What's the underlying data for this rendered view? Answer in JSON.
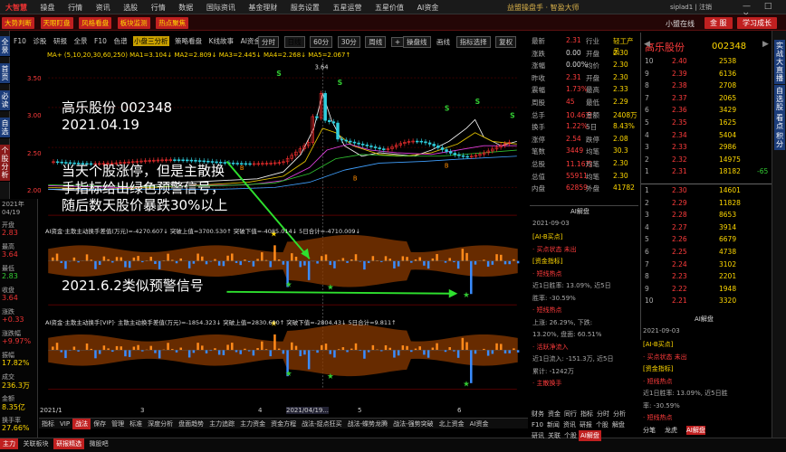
{
  "titlebar": {
    "logo": "大智慧",
    "menus": [
      "操盘",
      "行情",
      "资讯",
      "选股",
      "行情",
      "数据",
      "国际资讯",
      "基金理财",
      "服务设置",
      "五星运营",
      "五星价值",
      "AI资金"
    ],
    "app_title": "益盟操盘手 · 智盈大师",
    "user": "siplad1 | 注销"
  },
  "toolbar": {
    "buttons": [
      "大势判断",
      "天眼盯盘",
      "风格看盘",
      "板块监测",
      "热点聚焦"
    ],
    "service": "小盟在线",
    "right_btns": [
      "金 服",
      "学习成长"
    ]
  },
  "left_side": [
    "全景",
    "首页",
    "必读",
    "自选",
    "个股分析"
  ],
  "right_side": [
    "实战大直播",
    "自选股",
    "看点",
    "积分"
  ],
  "chart_tabs": {
    "items": [
      "F10",
      "诊股",
      "研报",
      "全景",
      "F10",
      "色谱",
      "小盘三分析",
      "策略看盘",
      "K线故事",
      "AI资金"
    ],
    "active": "小盘三分析",
    "period": [
      "分时",
      "日线",
      "60分",
      "30分",
      "周线"
    ],
    "period_active": "日线",
    "right_items": [
      "操盘线",
      "画线",
      "指标选择",
      "复权"
    ]
  },
  "ma_line": "MA+ (5,10,20,30,60,250)  MA1=3.104↓ MA2=2.809↓ MA3=2.445↓ MA4=2.268↓ MA5=2.067↑",
  "price_axis": [
    "3.50",
    "3.00",
    "2.50",
    "2.00"
  ],
  "high_label": "3.64",
  "left_info": {
    "date": "2021年\n04/19",
    "rows": [
      {
        "k": "开盘",
        "v": "2.83"
      },
      {
        "k": "最高",
        "v": "3.64"
      },
      {
        "k": "最低",
        "v": "2.83"
      },
      {
        "k": "收盘",
        "v": "3.64"
      },
      {
        "k": "涨跌",
        "v": "+0.33"
      },
      {
        "k": "涨跌幅",
        "v": "+9.97%"
      },
      {
        "k": "振幅",
        "v": "17.82%"
      },
      {
        "k": "成交",
        "v": "236.3万"
      },
      {
        "k": "金额",
        "v": "8.35亿"
      },
      {
        "k": "换手率",
        "v": "27.66%"
      }
    ]
  },
  "annotation": {
    "line1": "高乐股份  002348",
    "line2": "2021.04.19",
    "line3": "当天个股涨停，但是主散换手指标给出绿色预警信号，随后数天股价暴跌30%以上",
    "line4": "2021.6.2类似预警信号"
  },
  "indicator1_label": "AI资金·主散主动换手差值(万元)=-4270.607↓  突破上值=3700.530↑  突破下值=-4085.014↓  5日合计=-4710.009↓",
  "indicator2_label": "AI资金·主散主动换手[VIP]·  主散主动换手差值(万元)=-1854.323↓  突破上值=2830.690↑  突破下值=-2804.43↓  5日合计=9.811↑",
  "date_axis": {
    "start": "2021/1",
    "mid": "2021/04/19...",
    "nums": [
      "3",
      "4",
      "5",
      "6"
    ]
  },
  "bottom_tabs": [
    "指标",
    "VIP",
    "战法",
    "保存",
    "管理",
    "标准",
    "深度分析",
    "盘面趋势",
    "主力追踪",
    "主力资金",
    "资金方程",
    "战法-捉点狂买",
    "战法-蝶势龙腾",
    "战法-强势突破",
    "北上资金",
    "AI资金"
  ],
  "bottom_active": "战法",
  "status_items": [
    "主力",
    "关联板块",
    "研报精选",
    "微股吧"
  ],
  "quote": {
    "rows": [
      {
        "a": "最新",
        "b": "2.31",
        "c": "行业",
        "d": "轻工产品"
      },
      {
        "a": "涨跌",
        "b": "0.00",
        "c": "开盘",
        "d": "2.30"
      },
      {
        "a": "涨幅",
        "b": "0.00%",
        "c": "均价",
        "d": "2.30"
      },
      {
        "a": "昨收",
        "b": "2.31",
        "c": "开盘",
        "d": "2.30"
      },
      {
        "a": "震幅",
        "b": "1.73%",
        "c": "最高",
        "d": "2.33"
      },
      {
        "a": "周股",
        "b": "45",
        "c": "最低",
        "d": "2.29"
      },
      {
        "a": "总手",
        "b": "10.46万",
        "c": "金额",
        "d": "2408万"
      },
      {
        "a": "换手",
        "b": "1.22%",
        "c": "5日",
        "d": "8.43%"
      },
      {
        "a": "涨停",
        "b": "2.54",
        "c": "跌停",
        "d": "2.08"
      },
      {
        "a": "笔数",
        "b": "3449",
        "c": "均笔",
        "d": "30.3"
      },
      {
        "a": "总股",
        "b": "11.16万",
        "c": "均笔",
        "d": "2.30"
      },
      {
        "a": "总值",
        "b": "55911",
        "c": "均笔",
        "d": "2.30"
      },
      {
        "a": "内盘",
        "b": "62859",
        "c": "外盘",
        "d": "41782"
      }
    ]
  },
  "ai_panel1": {
    "title": "AI解盘",
    "date": "2021-09-03",
    "lines": [
      "[AI-B买点]",
      "· 买点状态 未出",
      "[资金指标]",
      "· 短线热点",
      "近1日胜率: 13.09%, 近5日",
      "胜率: -30.59%",
      "· 短线热点",
      "上涨: 26.29%, 下跌:",
      "13.20%, 盘面: 60.51%",
      "· 活跃净流入",
      "近1日流入: -151.3万, 近5日",
      "累计: -1242万",
      "· 主散换手"
    ]
  },
  "func_tabs": [
    "财务",
    "资金",
    "同行",
    "指标",
    "分时",
    "分析",
    "F10",
    "新闻",
    "资讯",
    "研报",
    "个股",
    "解盘",
    "研讯",
    "关联",
    "个股",
    "AI解盘"
  ],
  "orderbook": {
    "name": "高乐股份",
    "code": "002348",
    "sell": [
      {
        "n": "10",
        "p": "2.40",
        "v": "2538"
      },
      {
        "n": "9",
        "p": "2.39",
        "v": "6136"
      },
      {
        "n": "8",
        "p": "2.38",
        "v": "2708"
      },
      {
        "n": "7",
        "p": "2.37",
        "v": "2065"
      },
      {
        "n": "6",
        "p": "2.36",
        "v": "3429"
      },
      {
        "n": "5",
        "p": "2.35",
        "v": "1625"
      },
      {
        "n": "4",
        "p": "2.34",
        "v": "5404"
      },
      {
        "n": "3",
        "p": "2.33",
        "v": "2986"
      },
      {
        "n": "2",
        "p": "2.32",
        "v": "14975"
      },
      {
        "n": "1",
        "p": "2.31",
        "v": "18182",
        "d": "-65"
      }
    ],
    "buy": [
      {
        "n": "1",
        "p": "2.30",
        "v": "14601"
      },
      {
        "n": "2",
        "p": "2.29",
        "v": "11828"
      },
      {
        "n": "3",
        "p": "2.28",
        "v": "8653"
      },
      {
        "n": "4",
        "p": "2.27",
        "v": "3914"
      },
      {
        "n": "5",
        "p": "2.26",
        "v": "6679"
      },
      {
        "n": "6",
        "p": "2.25",
        "v": "4738"
      },
      {
        "n": "7",
        "p": "2.24",
        "v": "3102"
      },
      {
        "n": "8",
        "p": "2.23",
        "v": "2201"
      },
      {
        "n": "9",
        "p": "2.22",
        "v": "1948"
      },
      {
        "n": "10",
        "p": "2.21",
        "v": "3320"
      }
    ]
  },
  "ai_panel2": {
    "title": "AI解盘",
    "date": "2021-09-03",
    "lines": [
      "[AI-B买点]",
      "· 买点状态 未出",
      "[资金指标]",
      "· 短线热点",
      "近1日胜率: 13.09%, 近5日胜",
      "率: -30.59%",
      "· 短线热点"
    ]
  },
  "ob_bottom_tabs": [
    "分笔",
    "龙虎",
    "AI解盘"
  ]
}
